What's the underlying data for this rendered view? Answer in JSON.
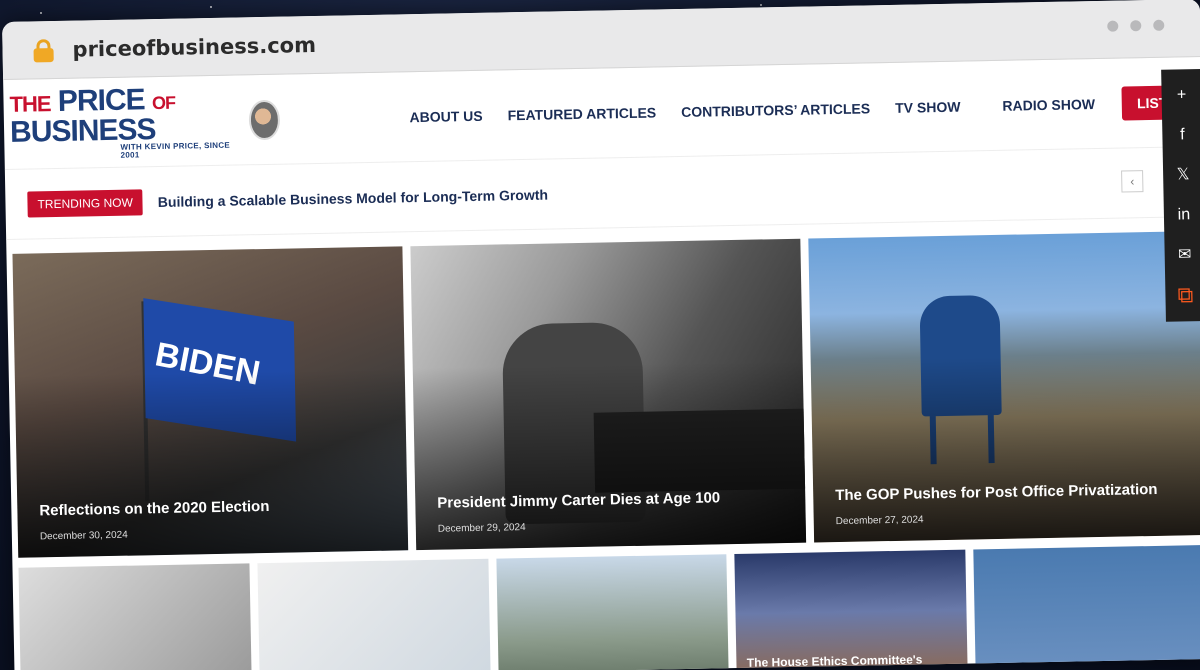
{
  "browser": {
    "url": "priceofbusiness.com"
  },
  "header": {
    "logo": {
      "the": "THE",
      "price": "PRICE",
      "of": "OF",
      "business": "BUSINESS",
      "tagline": "WITH KEVIN PRICE, SINCE 2001"
    },
    "nav": [
      {
        "label": "ABOUT US"
      },
      {
        "label": "FEATURED ARTICLES"
      },
      {
        "label": "CONTRIBUTORS’ ARTICLES"
      },
      {
        "label": "TV SHOW"
      },
      {
        "label": "RADIO SHOW"
      }
    ],
    "listen_label": "LISTEN"
  },
  "trending": {
    "badge": "TRENDING NOW",
    "headline": "Building a Scalable Business Model for Long-Term Growth",
    "prev_icon": "chevron-left-icon"
  },
  "hero": [
    {
      "title": "Reflections on the 2020 Election",
      "date": "December 30, 2024",
      "flag_text": "BIDEN"
    },
    {
      "title": "President Jimmy Carter Dies at Age 100",
      "date": "December 29, 2024"
    },
    {
      "title": "The GOP Pushes for Post Office Privatization",
      "date": "December 27, 2024"
    }
  ],
  "thumbs": [
    {
      "caption": ""
    },
    {
      "caption": ""
    },
    {
      "caption": ""
    },
    {
      "caption": "The House Ethics Committee's"
    },
    {
      "caption": ""
    }
  ],
  "share_bar": [
    "plus-icon",
    "facebook-icon",
    "twitter-icon",
    "linkedin-icon",
    "email-icon",
    "share-icon"
  ]
}
